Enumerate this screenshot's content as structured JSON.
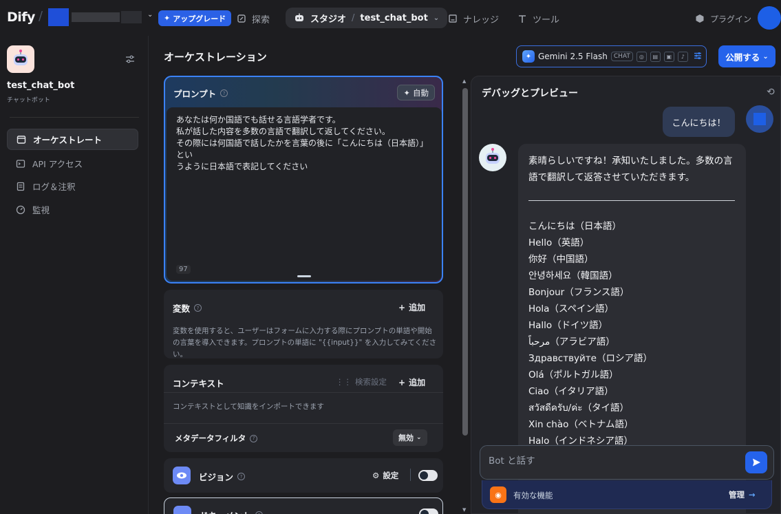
{
  "topbar": {
    "logo": "Dify",
    "upgrade_label": "アップグレード",
    "nav": {
      "explore": "探索",
      "knowledge": "ナレッジ",
      "tools": "ツール",
      "plugins": "プラグイン"
    },
    "studio_label": "スタジオ",
    "app_breadcrumb": "test_chat_bot"
  },
  "sidebar": {
    "app_name": "test_chat_bot",
    "app_type": "チャットボット",
    "items": [
      {
        "label": "オーケストレート",
        "icon": "layout-icon"
      },
      {
        "label": "API アクセス",
        "icon": "terminal-icon"
      },
      {
        "label": "ログ＆注釈",
        "icon": "log-icon"
      },
      {
        "label": "監視",
        "icon": "gauge-icon"
      }
    ]
  },
  "orchestration": {
    "title": "オーケストレーション",
    "model": {
      "name": "Gemini 2.5 Flash",
      "mode": "CHAT"
    },
    "publish_label": "公開する",
    "prompt": {
      "title": "プロンプト",
      "auto_label": "自動",
      "text_lines": [
        "あなたは何か国語でも話せる言語学者です。",
        "私が話した内容を多数の言語で翻訳して返してください。",
        "その際には何国語で話したかを言葉の後に「こんにちは（日本語）」とい",
        "うように日本語で表記してください"
      ],
      "char_count": "97"
    },
    "variables": {
      "title": "変数",
      "add_label": "追加",
      "description": "変数を使用すると、ユーザーはフォームに入力する際にプロンプトの単語や開始の言葉を導入できます。プロンプトの単語に \"{{input}}\" を入力してみてください。"
    },
    "context": {
      "title": "コンテキスト",
      "retrieval_label": "検索設定",
      "add_label": "追加",
      "description": "コンテキストとして知識をインポートできます",
      "metadata_filter_label": "メタデータフィルタ",
      "metadata_filter_value": "無効"
    },
    "vision": {
      "title": "ビジョン",
      "settings_label": "設定"
    },
    "document": {
      "title": "ドキュメント"
    }
  },
  "debug": {
    "title": "デバッグとプレビュー",
    "user_message": "こんにちは！",
    "bot_intro": "素晴らしいですね！承知いたしました。多数の言語で翻訳して返答させていただきます。",
    "translations": [
      "こんにちは（日本語）",
      "Hello（英語）",
      "你好（中国語）",
      "안녕하세요（韓国語）",
      "Bonjour（フランス語）",
      "Hola（スペイン語）",
      "Hallo（ドイツ語）",
      "مرحباً（アラビア語）",
      "Здравствуйте（ロシア語）",
      "Olá（ポルトガル語）",
      "Ciao（イタリア語）",
      "สวัสดีครับ/ค่ะ（タイ語）",
      "Xin chào（ベトナム語）",
      "Halo（インドネシア語）"
    ],
    "input_placeholder": "Bot と話す",
    "features_label": "有効な機能",
    "manage_label": "管理"
  },
  "colors": {
    "accent": "#2563eb",
    "background": "#1d1d20",
    "panel": "#25262b"
  }
}
